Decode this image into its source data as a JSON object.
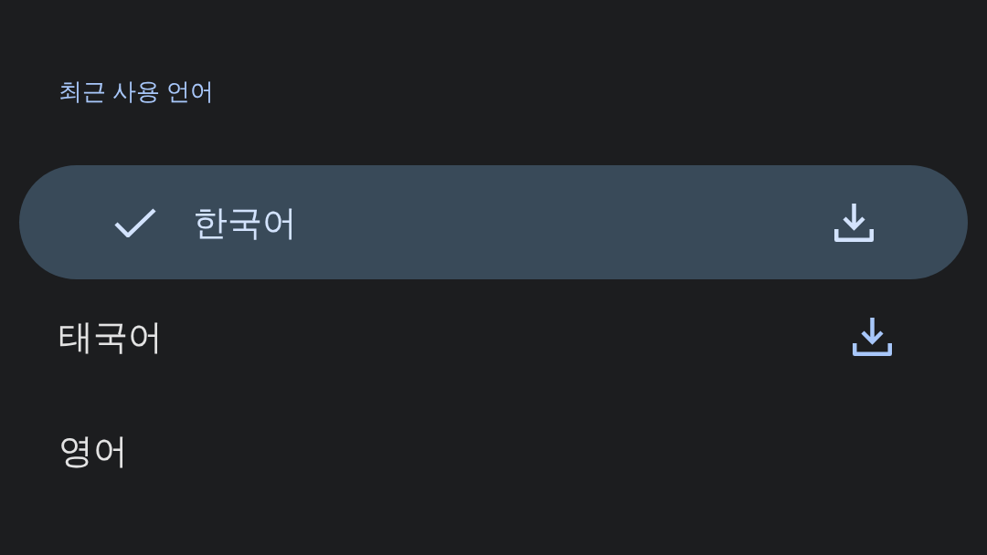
{
  "section_title": "최근 사용 언어",
  "languages": [
    {
      "label": "한국어",
      "selected": true,
      "download_available": true
    },
    {
      "label": "태국어",
      "selected": false,
      "download_available": true
    },
    {
      "label": "영어",
      "selected": false,
      "download_available": false
    }
  ]
}
